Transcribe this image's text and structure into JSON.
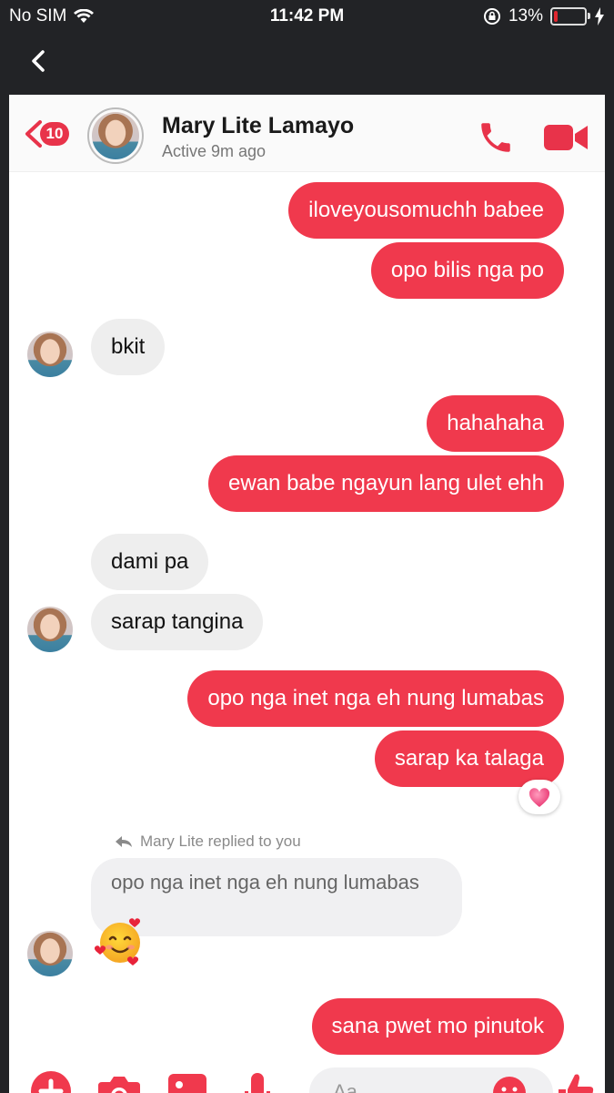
{
  "status_bar": {
    "carrier": "No SIM",
    "time": "11:42 PM",
    "battery_text": "13%",
    "battery_level": 0.13
  },
  "header": {
    "unread_badge": "10",
    "name": "Mary Lite Lamayo",
    "status": "Active 9m ago"
  },
  "messages": [
    {
      "dir": "out",
      "text": "iloveyousomuchh babee"
    },
    {
      "dir": "out",
      "text": "opo bilis nga po"
    },
    {
      "dir": "in",
      "text": "bkit"
    },
    {
      "dir": "out",
      "text": "hahahaha"
    },
    {
      "dir": "out",
      "text": "ewan babe ngayun lang ulet ehh"
    },
    {
      "dir": "in",
      "text": "dami pa"
    },
    {
      "dir": "in",
      "text": "sarap tangina"
    },
    {
      "dir": "out",
      "text": "opo nga inet nga eh nung lumabas"
    },
    {
      "dir": "out",
      "text": "sarap ka talaga"
    },
    {
      "dir": "out",
      "text": "sana pwet mo pinutok"
    }
  ],
  "reaction": "heart",
  "reply": {
    "notice": "Mary Lite replied to you",
    "quoted_text": "opo nga inet nga eh nung lumabas",
    "emoji": "smiling-face-with-hearts"
  },
  "composer": {
    "placeholder": "Aa"
  },
  "colors": {
    "accent": "#f0394d",
    "incoming_bubble": "#eeeeee",
    "outer_bg": "#222326"
  }
}
